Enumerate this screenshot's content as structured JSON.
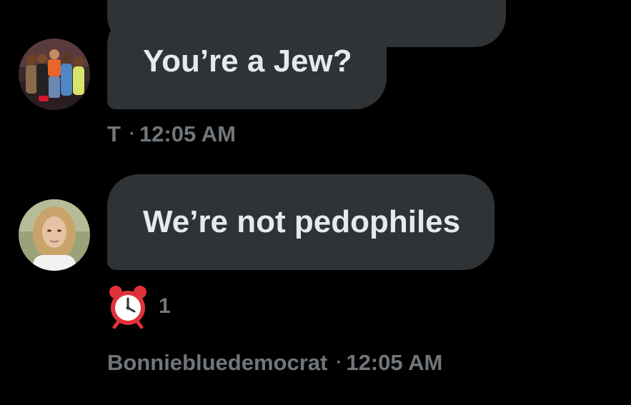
{
  "colors": {
    "background": "#000000",
    "bubble": "#2f3336",
    "bubble_text": "#e7e9ea",
    "meta_text": "#71767b"
  },
  "messages": [
    {
      "text": "You’re a Jew?",
      "sender": "T",
      "time": "12:05 AM",
      "avatar": "group-photo-avatar"
    },
    {
      "text": "We’re not pedophiles",
      "sender": "Bonniebluedemocrat",
      "time": "12:05 AM",
      "avatar": "profile-photo-avatar",
      "reaction": {
        "icon": "alarm-clock-icon",
        "count": "1"
      }
    }
  ],
  "separator": "·"
}
